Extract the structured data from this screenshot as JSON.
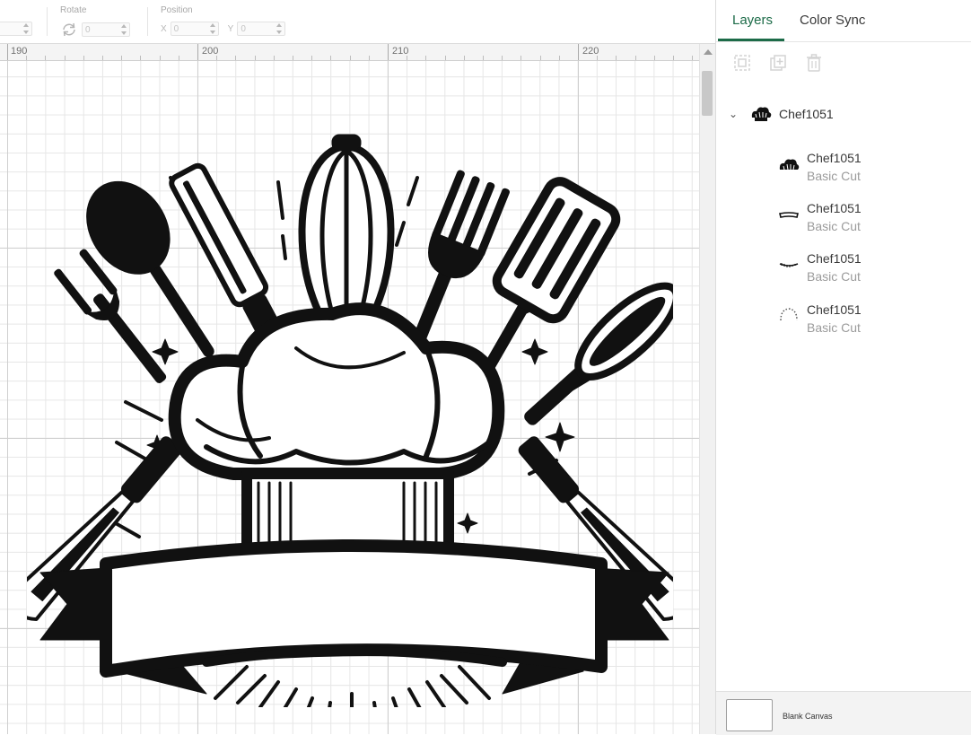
{
  "toolbar": {
    "size_value": "",
    "rotate_label": "Rotate",
    "rotate_value": "0",
    "position_label": "Position",
    "x_label": "X",
    "x_value": "0",
    "y_label": "Y",
    "y_value": "0"
  },
  "ruler": {
    "ticks": [
      "190",
      "200",
      "210",
      "220"
    ]
  },
  "panel": {
    "tabs": [
      {
        "label": "Layers",
        "active": true
      },
      {
        "label": "Color Sync",
        "active": false
      }
    ],
    "actions": [
      "group-icon",
      "duplicate-icon",
      "trash-icon"
    ],
    "group": {
      "name": "Chef1051",
      "expanded": true
    },
    "layers": [
      {
        "name": "Chef1051",
        "operation": "Basic Cut",
        "icon": "hat-top-thumb"
      },
      {
        "name": "Chef1051",
        "operation": "Basic Cut",
        "icon": "band-thumb"
      },
      {
        "name": "Chef1051",
        "operation": "Basic Cut",
        "icon": "stitch-thumb"
      },
      {
        "name": "Chef1051",
        "operation": "Basic Cut",
        "icon": "dotted-arc-thumb"
      }
    ],
    "footer": {
      "label": "Blank Canvas"
    }
  },
  "colors": {
    "accent": "#1c6b48",
    "art": "#111111"
  }
}
